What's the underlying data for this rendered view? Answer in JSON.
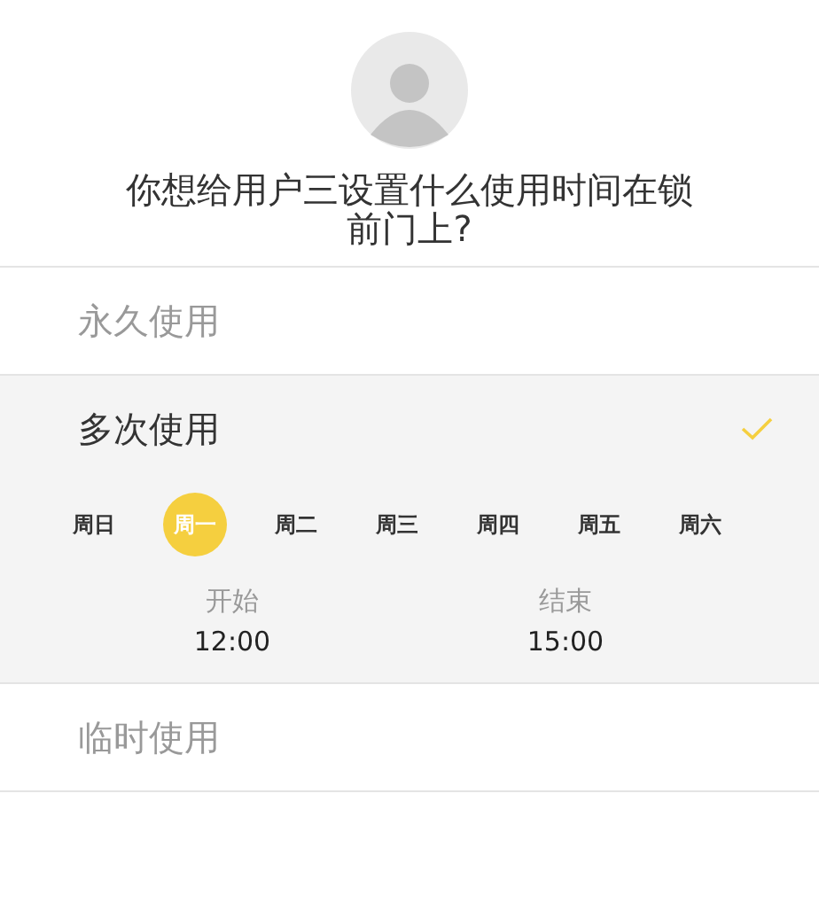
{
  "question": "你想给用户三设置什么使用时间在锁前门上?",
  "options": [
    {
      "label": "永久使用",
      "selected": false
    },
    {
      "label": "多次使用",
      "selected": true,
      "days": [
        {
          "label": "周日",
          "selected": false
        },
        {
          "label": "周一",
          "selected": true
        },
        {
          "label": "周二",
          "selected": false
        },
        {
          "label": "周三",
          "selected": false
        },
        {
          "label": "周四",
          "selected": false
        },
        {
          "label": "周五",
          "selected": false
        },
        {
          "label": "周六",
          "selected": false
        }
      ],
      "times": [
        {
          "label": "开始",
          "value": "12:00"
        },
        {
          "label": "结束",
          "value": "15:00"
        }
      ]
    },
    {
      "label": "临时使用",
      "selected": false
    }
  ]
}
